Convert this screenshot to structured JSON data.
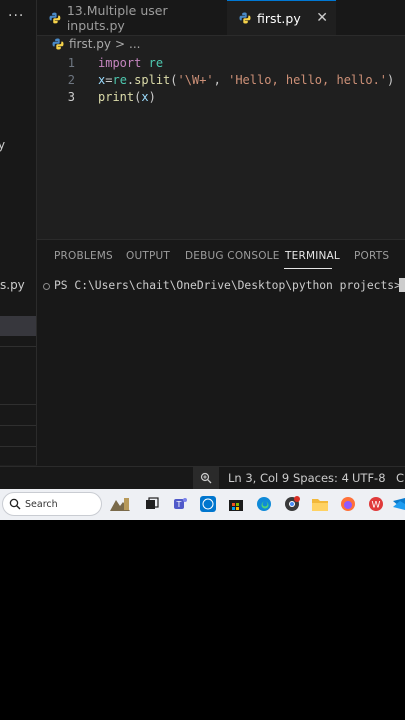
{
  "sidebar": {
    "more_label": "···",
    "fragment1": "y",
    "fragment2": "s.py"
  },
  "tabs": [
    {
      "label": "13.Multiple user inputs.py",
      "active": false
    },
    {
      "label": "first.py",
      "active": true
    }
  ],
  "breadcrumb": {
    "file": "first.py",
    "separator": ">",
    "more": "..."
  },
  "editor": {
    "lines": [
      {
        "number": "1",
        "text": "import re"
      },
      {
        "number": "2",
        "text": "x=re.split('\\W+', 'Hello, hello, hello.')"
      },
      {
        "number": "3",
        "text": "print(x)"
      }
    ],
    "active_line": 3
  },
  "panel": {
    "tabs": [
      "PROBLEMS",
      "OUTPUT",
      "DEBUG CONSOLE",
      "TERMINAL",
      "PORTS"
    ],
    "active_tab": "TERMINAL",
    "terminal_prompt": "PS C:\\Users\\chait\\OneDrive\\Desktop\\python projects>"
  },
  "statusbar": {
    "position": "Ln 3, Col 9",
    "spaces": "Spaces: 4",
    "encoding": "UTF-8",
    "eol": "CR"
  },
  "taskbar": {
    "search_placeholder": "Search",
    "icons": [
      "widgets-icon",
      "task-view-icon",
      "teams-icon",
      "dell-icon",
      "store-icon",
      "edge-icon",
      "chrome-icon",
      "file-explorer-icon",
      "firefox-icon",
      "wps-icon",
      "vscode-icon"
    ]
  },
  "colors": {
    "accent": "#0078d4",
    "keyword": "#c586c0",
    "function": "#dcdcaa",
    "variable": "#9cdcfe",
    "string": "#ce9178"
  }
}
